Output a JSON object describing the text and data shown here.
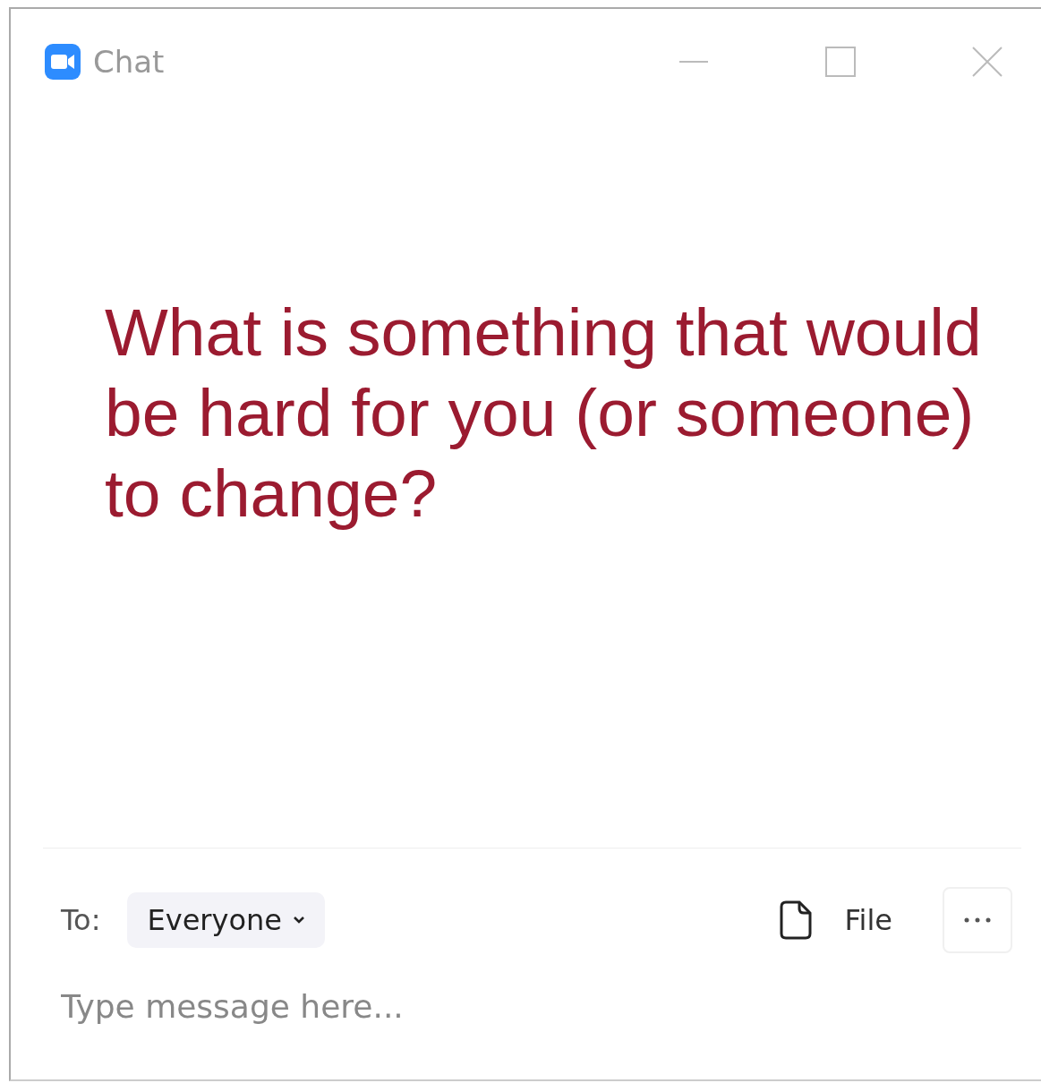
{
  "window": {
    "title": "Chat"
  },
  "message": "What is something that would be hard for you (or someone) to change?",
  "compose": {
    "to_label": "To:",
    "recipient": "Everyone",
    "file_label": "File",
    "placeholder": "Type message here..."
  }
}
